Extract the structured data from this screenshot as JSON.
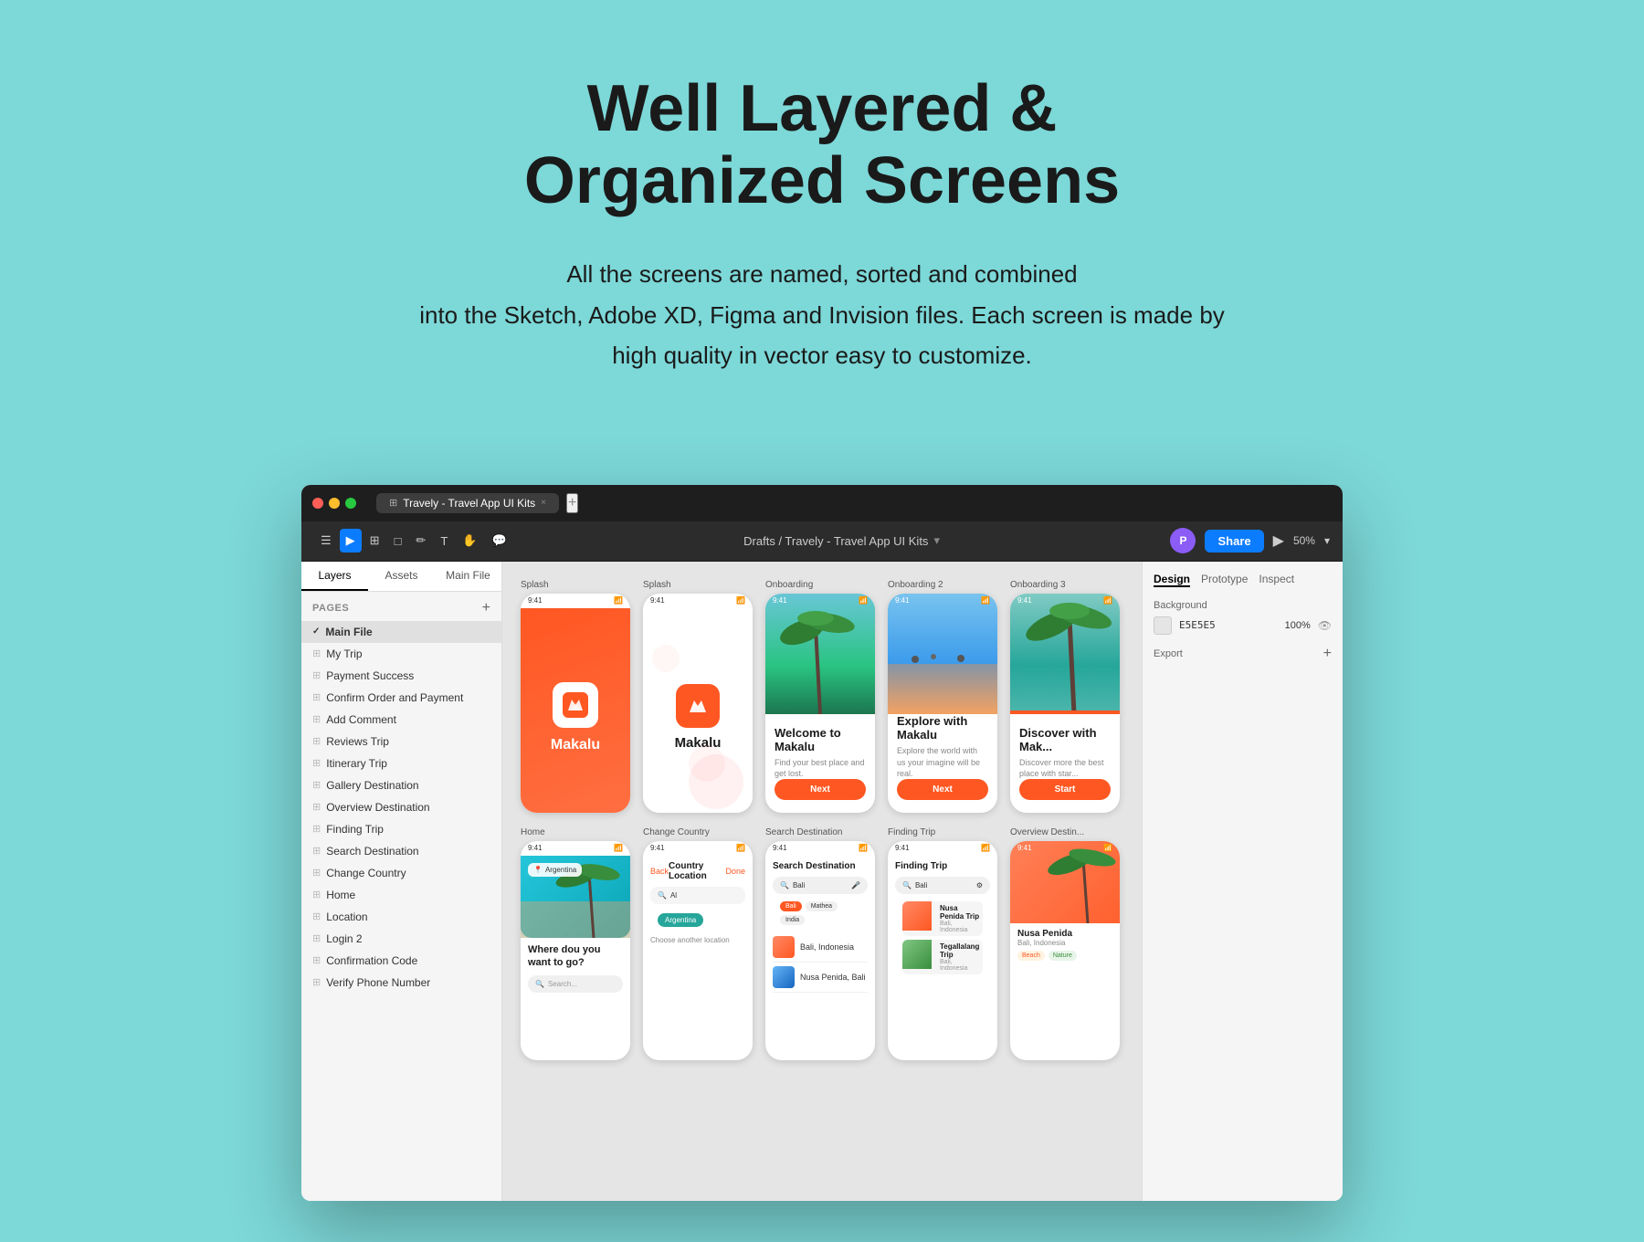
{
  "hero": {
    "title": "Well Layered &\nOrganized Screens",
    "subtitle": "All the screens are named, sorted and combined\ninto the Sketch, Adobe XD, Figma and Invision files. Each screen is made by\nhigh quality in vector easy to customize."
  },
  "titleBar": {
    "tab_label": "Travely - Travel App UI Kits",
    "tab_separator": "×",
    "tab_plus": "+"
  },
  "toolbar": {
    "breadcrumb": "Drafts / Travely - Travel App UI Kits",
    "share_label": "Share",
    "zoom_label": "50%",
    "avatar_initials": "P"
  },
  "sidebar": {
    "tabs": [
      "Layers",
      "Assets"
    ],
    "file_label": "Main File",
    "pages_header": "Pages",
    "pages_add": "+",
    "pages": [
      {
        "label": "Main File",
        "icon": "check",
        "active": true
      },
      {
        "label": "My Trip",
        "icon": "hash"
      },
      {
        "label": "Payment Success",
        "icon": "hash"
      },
      {
        "label": "Confirm Order and Payment",
        "icon": "hash"
      },
      {
        "label": "Add Comment",
        "icon": "hash"
      },
      {
        "label": "Reviews Trip",
        "icon": "hash"
      },
      {
        "label": "Itinerary Trip",
        "icon": "hash"
      },
      {
        "label": "Gallery Destination",
        "icon": "hash"
      },
      {
        "label": "Overview Destination",
        "icon": "hash"
      },
      {
        "label": "Finding Trip",
        "icon": "hash"
      },
      {
        "label": "Search Destination",
        "icon": "hash"
      },
      {
        "label": "Change Country",
        "icon": "hash"
      },
      {
        "label": "Home",
        "icon": "hash"
      },
      {
        "label": "Location",
        "icon": "hash"
      },
      {
        "label": "Login 2",
        "icon": "hash"
      },
      {
        "label": "Confirmation Code",
        "icon": "hash"
      },
      {
        "label": "Verify Phone Number",
        "icon": "hash"
      }
    ]
  },
  "rightPanel": {
    "tabs": [
      "Design",
      "Prototype",
      "Inspect"
    ],
    "background_label": "Background",
    "bg_color": "E5E5E5",
    "bg_opacity": "100%",
    "export_label": "Export"
  },
  "frames": {
    "row1": [
      {
        "label": "Splash",
        "type": "splash_orange"
      },
      {
        "label": "Splash",
        "type": "splash_white"
      },
      {
        "label": "Onboarding",
        "type": "onboarding1"
      },
      {
        "label": "Onboarding 2",
        "type": "onboarding2"
      },
      {
        "label": "Onboarding 3",
        "type": "onboarding3"
      }
    ],
    "row2": [
      {
        "label": "Home",
        "type": "home"
      },
      {
        "label": "Change Country",
        "type": "change_country"
      },
      {
        "label": "Search Destination",
        "type": "search_dest"
      },
      {
        "label": "Finding Trip",
        "type": "finding_trip"
      },
      {
        "label": "Overview Destin...",
        "type": "overview_dest"
      }
    ]
  },
  "onboarding1": {
    "title": "Welcome\nto Makalu",
    "desc": "Find your best place and get lost.",
    "btn": "Next"
  },
  "onboarding2": {
    "title": "Explore\nwith Makalu",
    "desc": "Explore the world with us your imagine will be real.",
    "btn": "Next"
  },
  "onboarding3": {
    "title": "Discover\nwith Mak...",
    "desc": "Discover more the best place with star...",
    "btn": "Start"
  },
  "home": {
    "question": "Where dou you\nwant to go?"
  },
  "changeCountry": {
    "back": "Back",
    "label": "Country Location",
    "done": "Done",
    "input": "Al",
    "location_chip": "Argentina",
    "choose": "Choose another location"
  },
  "searchDest": {
    "label": "Search Destination",
    "input": "Bali",
    "chips": [
      "Bali",
      "Mathea",
      "India"
    ]
  },
  "findingTrip": {
    "input": "Bali",
    "trip": "Nusa Penida Trip"
  },
  "makalu": {
    "app_name": "Makalu"
  }
}
